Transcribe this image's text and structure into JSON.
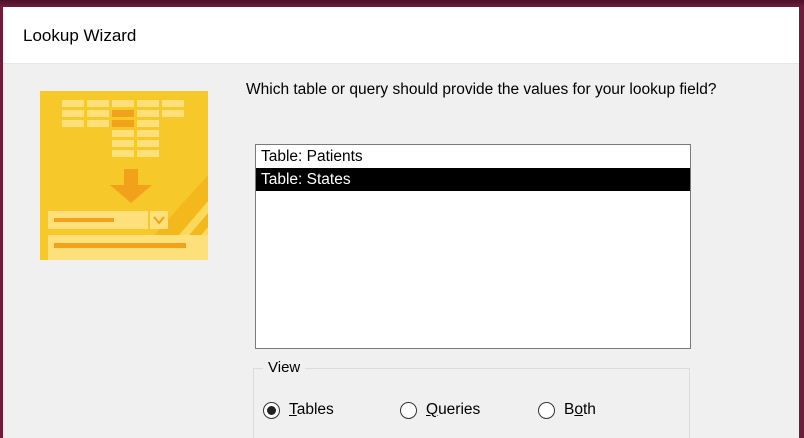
{
  "window": {
    "title": "Lookup Wizard"
  },
  "prompt": "Which table or query should provide the values for your lookup field?",
  "list": {
    "items": [
      {
        "label": "Table: Patients",
        "selected": false
      },
      {
        "label": "Table: States",
        "selected": true
      }
    ]
  },
  "view": {
    "legend": "View",
    "options": [
      {
        "mnemonic": "T",
        "rest": "ables",
        "checked": true
      },
      {
        "mnemonic": "Q",
        "rest": "ueries",
        "checked": false
      },
      {
        "prefix": "B",
        "mnemonic": "o",
        "rest": "th",
        "checked": false
      }
    ]
  },
  "colors": {
    "frame": "#6e1c3a",
    "dialog_bg": "#f0f0f0",
    "selection_bg": "#000000",
    "wizard_art": "#f7c82a"
  },
  "icons": {
    "wizard_art": "lookup-wizard-illustration"
  }
}
